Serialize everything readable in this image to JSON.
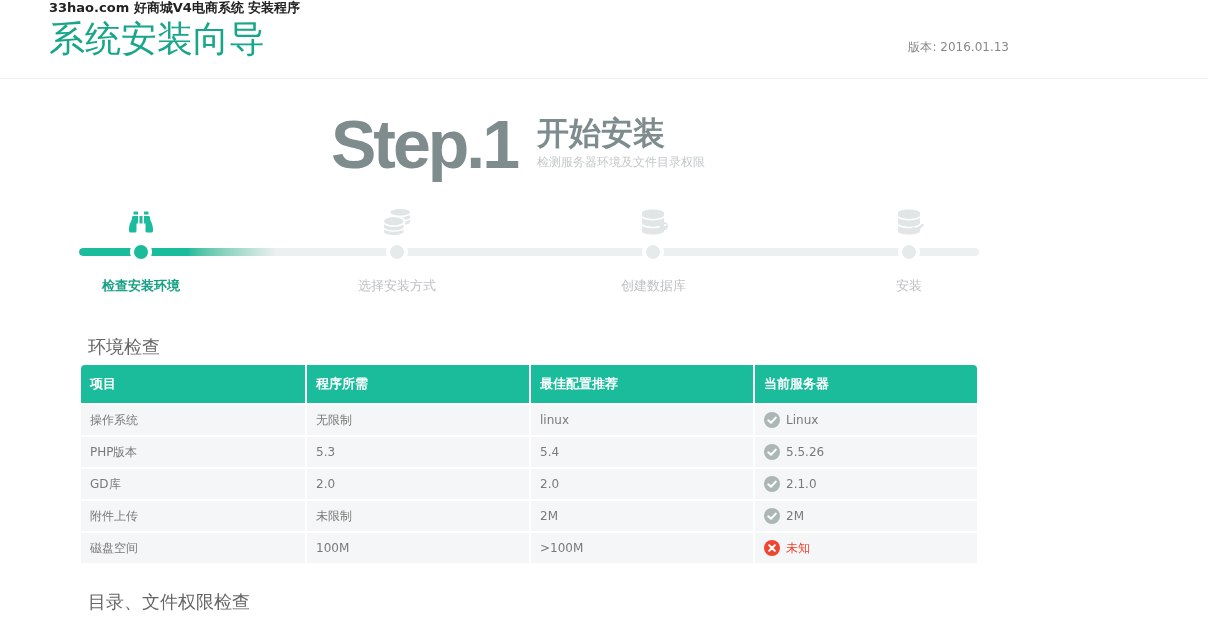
{
  "header": {
    "site_title": "33hao.com 好商城V4电商系统 安装程序",
    "title": "系统安装向导",
    "version": "版本: 2016.01.13"
  },
  "step_heading": {
    "step": "Step.1",
    "title": "开始安装",
    "subtitle": "检测服务器环境及文件目录权限"
  },
  "progress": {
    "level": 0.22,
    "steps": [
      {
        "label": "检查安装环境",
        "selected": true
      },
      {
        "label": "选择安装方式",
        "selected": false
      },
      {
        "label": "创建数据库",
        "selected": false
      },
      {
        "label": "安装",
        "selected": false
      }
    ]
  },
  "environment_check": {
    "title": "环境检查",
    "columns": [
      "项目",
      "程序所需",
      "最佳配置推荐",
      "当前服务器"
    ],
    "rows": [
      {
        "cells": [
          "操作系统",
          "无限制",
          "linux"
        ],
        "server": {
          "value": "Linux",
          "passed": true
        }
      },
      {
        "cells": [
          "PHP版本",
          "5.3",
          "5.4"
        ],
        "server": {
          "value": "5.5.26",
          "passed": true
        }
      },
      {
        "cells": [
          "GD库",
          "2.0",
          "2.0"
        ],
        "server": {
          "value": "2.1.0",
          "passed": true
        }
      },
      {
        "cells": [
          "附件上传",
          "未限制",
          "2M"
        ],
        "server": {
          "value": "2M",
          "passed": true
        }
      },
      {
        "cells": [
          "磁盘空间",
          "100M",
          ">100M"
        ],
        "server": {
          "value": "未知",
          "passed": false
        }
      }
    ]
  },
  "permission_check": {
    "title": "目录、文件权限检查"
  }
}
